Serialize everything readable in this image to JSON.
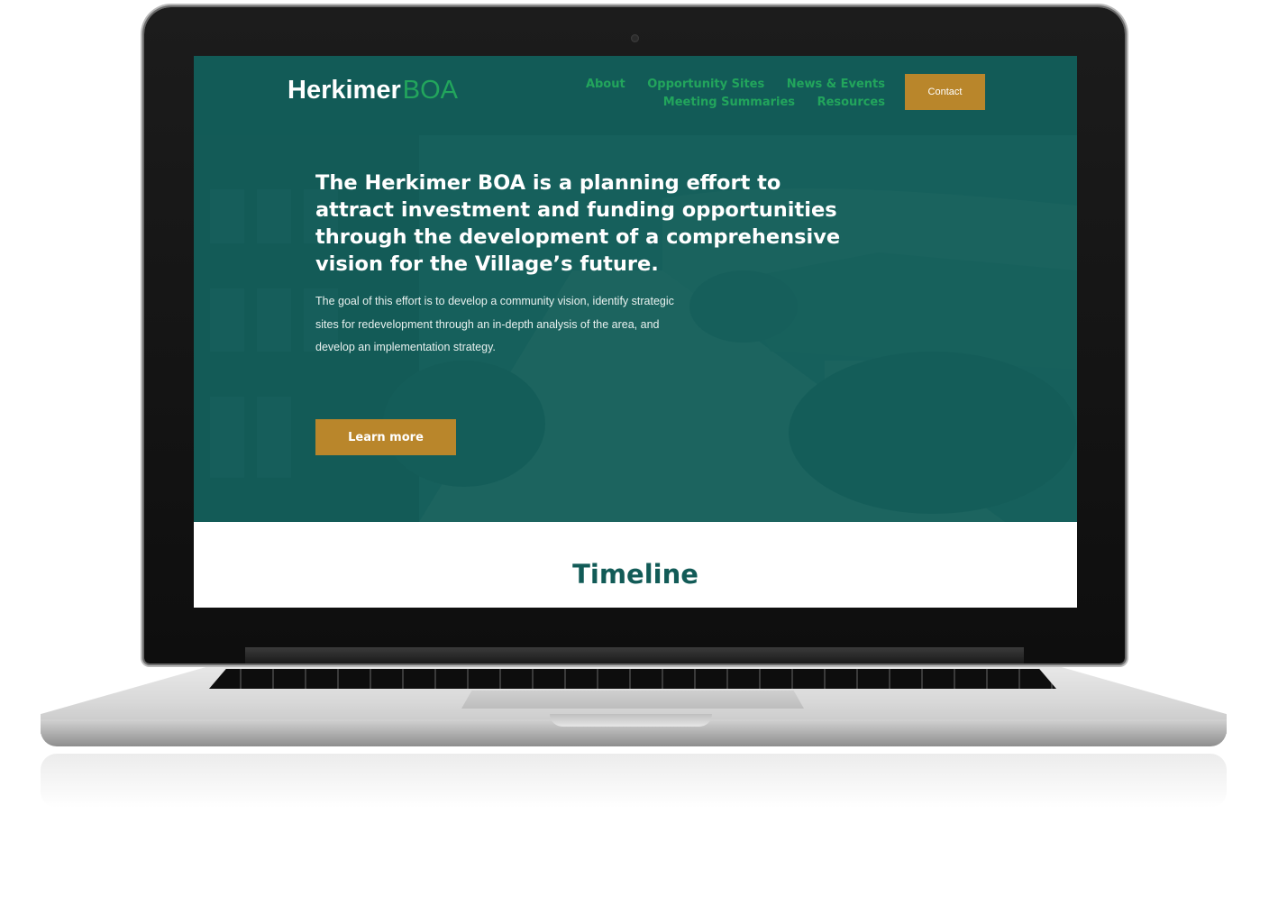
{
  "site": {
    "logo_primary": "Herkimer",
    "logo_secondary": "BOA",
    "brand_colors": {
      "primary": "#125b57",
      "accent_green": "#22a55c",
      "gold": "#b9862b"
    }
  },
  "nav": {
    "row1": [
      "About",
      "Opportunity Sites",
      "News & Events"
    ],
    "row2": [
      "Meeting Summaries",
      "Resources"
    ],
    "contact_label": "Contact"
  },
  "hero": {
    "headline": "The Herkimer BOA is a planning effort to attract investment and funding opportunities through the development of a comprehensive vision for the Village’s future.",
    "body": "The goal of this effort is to develop a community vision, identify strategic sites for redevelopment through an in-depth analysis of the area, and develop an implementation strategy.",
    "cta_label": "Learn more"
  },
  "timeline": {
    "title": "Timeline"
  }
}
